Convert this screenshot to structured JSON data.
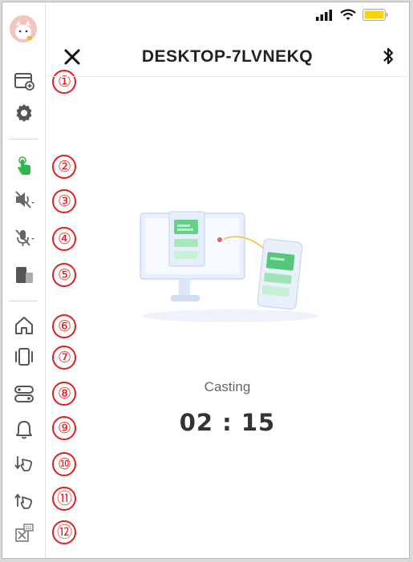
{
  "header": {
    "title": "DESKTOP-7LVNEKQ"
  },
  "casting": {
    "status_label": "Casting",
    "timer": "02 : 15"
  },
  "colors": {
    "accent": "#2eb84b",
    "annotation": "#e0211e",
    "battery": "#f7d20f"
  },
  "callouts": [
    "①",
    "②",
    "③",
    "④",
    "⑤",
    "⑥",
    "⑦",
    "⑧",
    "⑨",
    "⑩",
    "⑪",
    "⑫"
  ],
  "sidebar": {
    "icons": [
      "avatar",
      "new-window-icon",
      "gear-icon",
      "touch-control-icon",
      "speaker-muted-icon",
      "microphone-muted-icon",
      "device-switch-icon",
      "home-icon",
      "recent-apps-icon",
      "toggle-switch-icon",
      "notification-bell-icon",
      "swipe-down-icon",
      "swipe-up-icon",
      "keyboard-icon"
    ]
  }
}
